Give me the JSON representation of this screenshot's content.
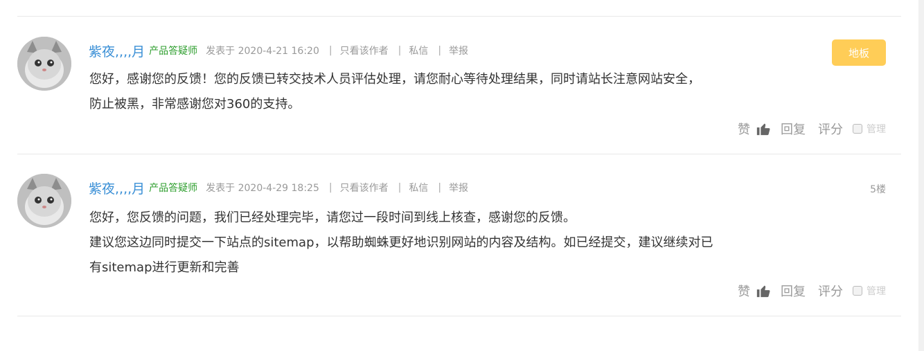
{
  "posts": [
    {
      "author": "紫夜,,,,月",
      "role": "产品答疑师",
      "posted": "发表于 2020-4-21 16:20",
      "only_author": "只看该作者",
      "private_msg": "私信",
      "report": "举报",
      "floor": "地板",
      "content": [
        "您好，感谢您的反馈！您的反馈已转交技术人员评估处理，请您耐心等待处理结果，同时请站长注意网站安全，",
        "防止被黑，非常感谢您对360的支持。"
      ],
      "actions": {
        "like": "赞",
        "reply": "回复",
        "rate": "评分",
        "manage": "管理"
      }
    },
    {
      "author": "紫夜,,,,月",
      "role": "产品答疑师",
      "posted": "发表于 2020-4-29 18:25",
      "only_author": "只看该作者",
      "private_msg": "私信",
      "report": "举报",
      "floor": "5楼",
      "content": [
        "您好，您反馈的问题，我们已经处理完毕，请您过一段时间到线上核查，感谢您的反馈。",
        "建议您这边同时提交一下站点的sitemap，以帮助蜘蛛更好地识别网站的内容及结构。如已经提交，建议继续对已",
        "有sitemap进行更新和完善"
      ],
      "actions": {
        "like": "赞",
        "reply": "回复",
        "rate": "评分",
        "manage": "管理"
      }
    }
  ],
  "colors": {
    "author": "#3a8fd6",
    "role": "#2d9e2d",
    "badge": "#ffcd57"
  }
}
